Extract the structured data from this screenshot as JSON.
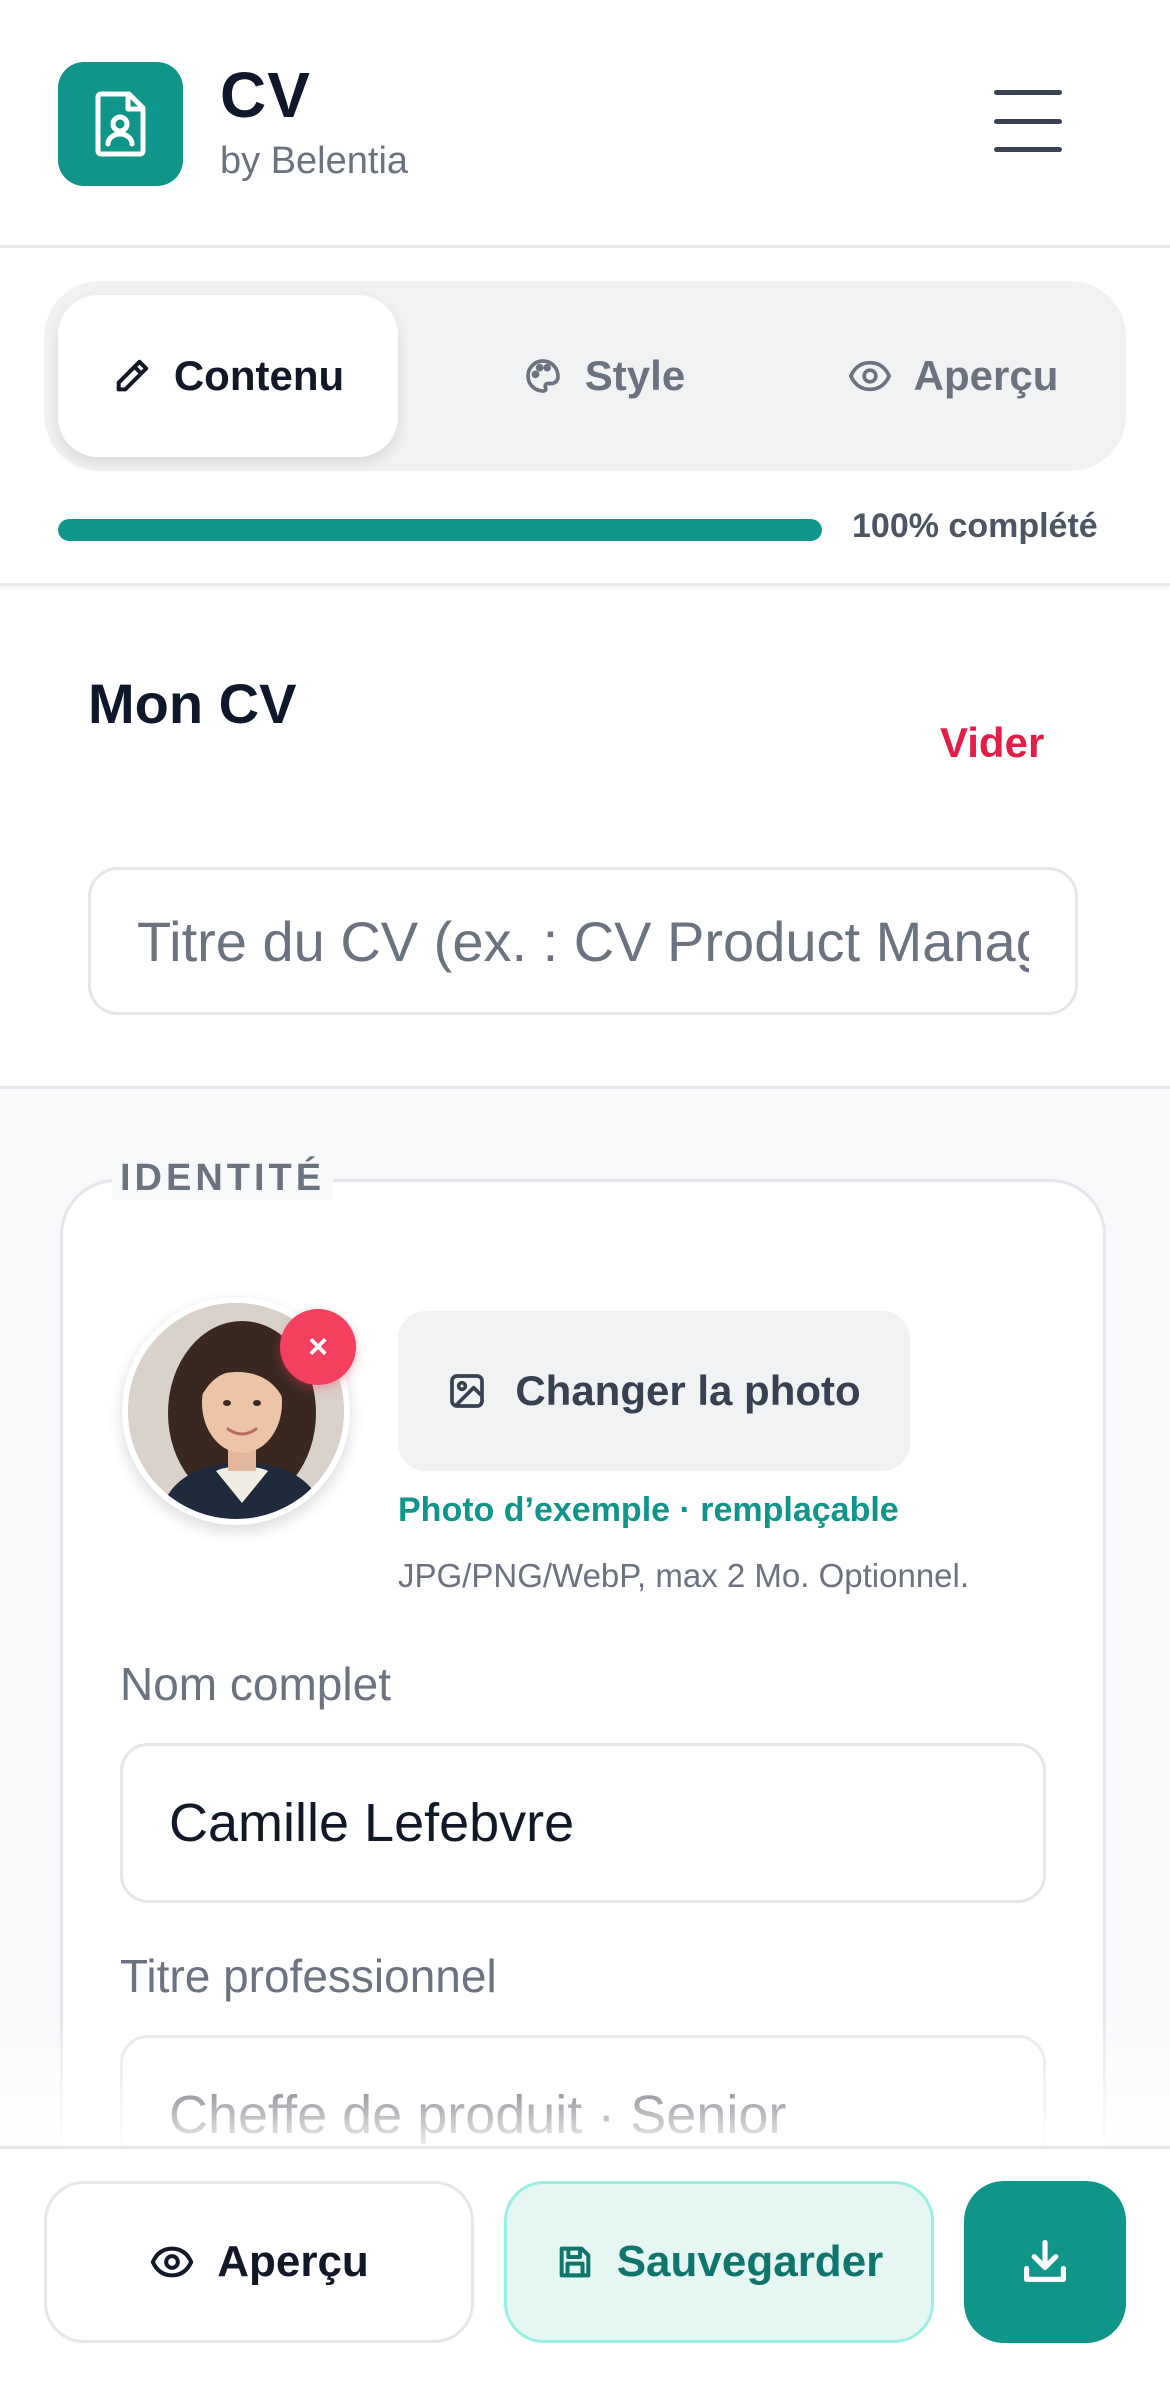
{
  "app": {
    "title": "CV",
    "subtitle": "by Belentia",
    "brand_color": "#10958a",
    "logo_icon": "document-person-icon",
    "menu_icon": "hamburger-menu-icon"
  },
  "tabs": [
    {
      "label": "Contenu",
      "icon": "pencil-icon",
      "active": true
    },
    {
      "label": "Style",
      "icon": "palette-icon",
      "active": false
    },
    {
      "label": "Aperçu",
      "icon": "eye-icon",
      "active": false
    }
  ],
  "progress": {
    "percent": 100,
    "label": "100% complété"
  },
  "cv": {
    "heading": "Mon CV",
    "clear_label": "Vider",
    "clear_color": "#e11d48",
    "title_input": {
      "value": "",
      "placeholder": "Titre du CV (ex. : CV Product Manager)"
    }
  },
  "identity": {
    "section_label": "IDENTITÉ",
    "photo": {
      "remove_label": "×",
      "change_label": "Changer la photo",
      "note": "Photo d’exemple · remplaçable",
      "hint": "JPG/PNG/WebP, max 2 Mo. Optionnel."
    },
    "fields": [
      {
        "label": "Nom complet",
        "value": "Camille Lefebvre"
      },
      {
        "label": "Titre professionnel",
        "value": "Cheffe de produit · Senior"
      }
    ]
  },
  "bottom_bar": {
    "preview_label": "Aperçu",
    "save_label": "Sauvegarder",
    "download_icon": "download-icon"
  }
}
